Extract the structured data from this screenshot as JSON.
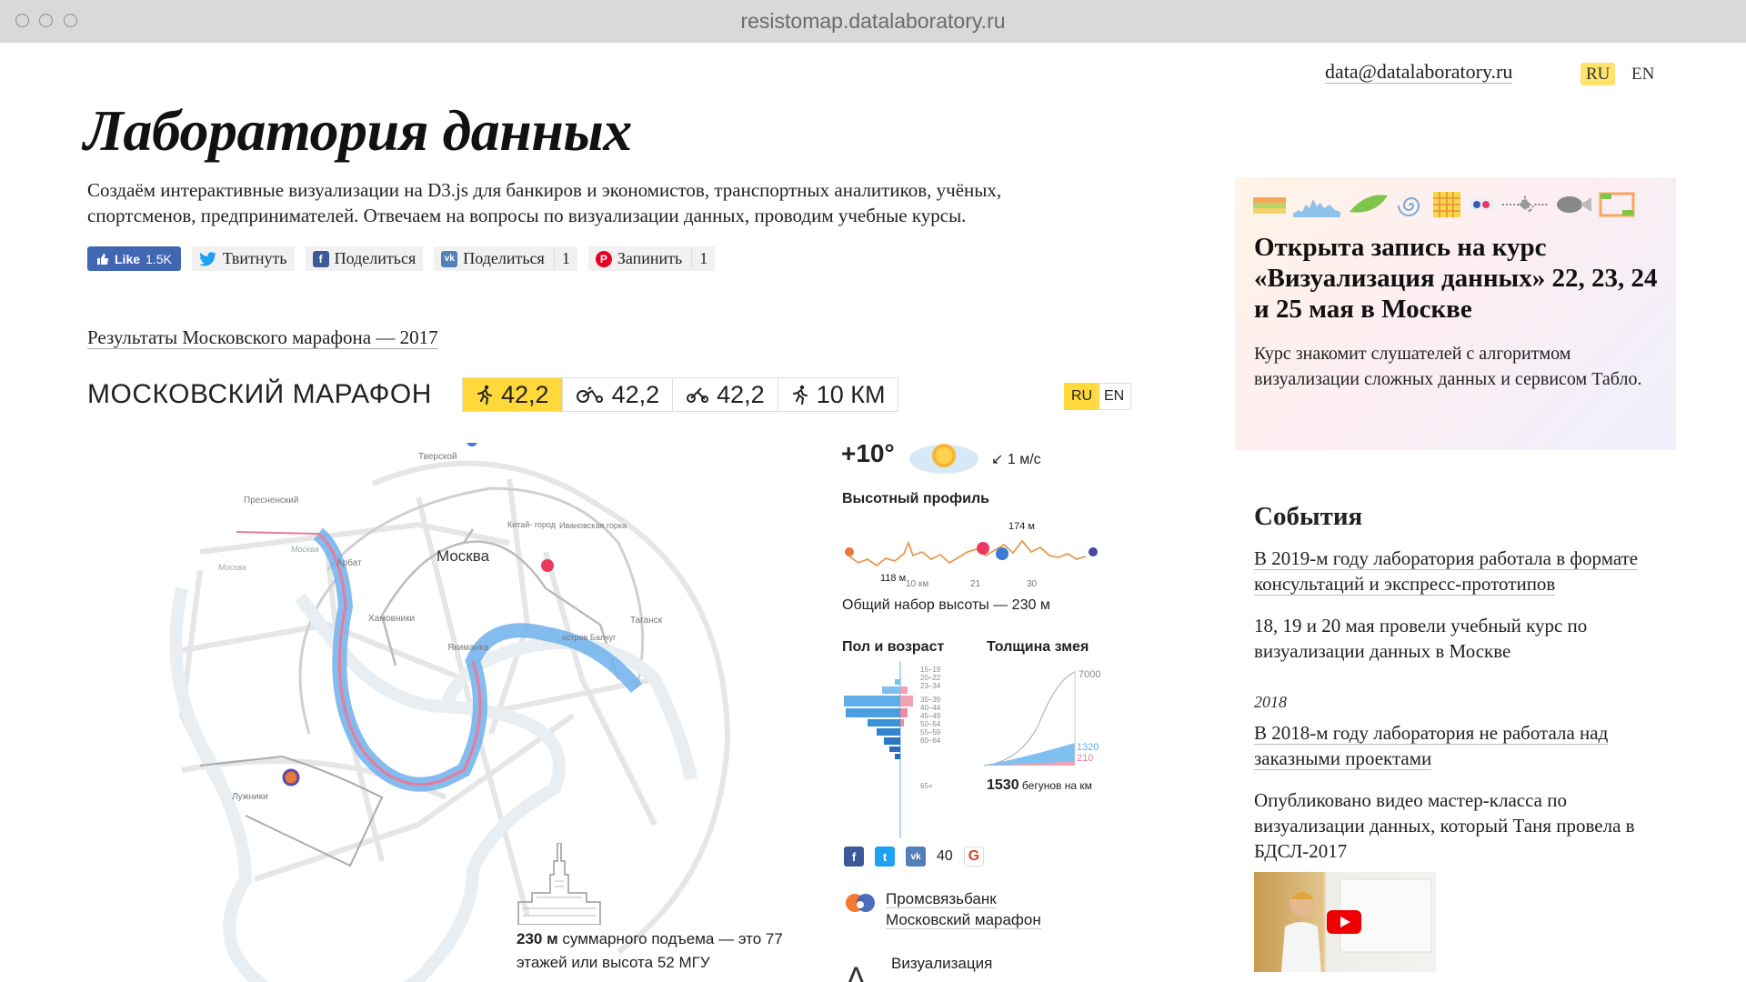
{
  "browser": {
    "url": "resistomap.datalaboratory.ru"
  },
  "header": {
    "email": "data@datalaboratory.ru",
    "lang_active": "RU",
    "lang_other": "EN"
  },
  "site": {
    "title": "Лаборатория данных",
    "intro": "Создаём интерактивные визуализации на D3.js для банкиров и экономистов, транспортных аналитиков, учёных, спортсменов, предпринимателей. Отвечаем на вопросы по визуализации данных, проводим учебные курсы."
  },
  "share": {
    "fb_like_label": "Like",
    "fb_like_count": "1.5K",
    "twitter_label": "Твитнуть",
    "facebook_label": "Поделиться",
    "vk_label": "Поделиться",
    "vk_count": "1",
    "pinterest_label": "Запинить",
    "pinterest_count": "1"
  },
  "results_link": "Результаты Московского марафона — 2017",
  "widget": {
    "title": "МОСКОВСКИЙ МАРАФОН",
    "tabs": [
      {
        "label": "42,2",
        "icon": "runner-icon",
        "active": true
      },
      {
        "label": "42,2",
        "icon": "wheelchair-icon",
        "active": false
      },
      {
        "label": "42,2",
        "icon": "handbike-icon",
        "active": false
      },
      {
        "label": "10 КМ",
        "icon": "runner-icon",
        "active": false
      }
    ],
    "lang_active": "RU",
    "lang_other": "EN",
    "map_labels": {
      "moscow": "Москва",
      "tverskoy": "Тверской",
      "presnensky": "Пресненский",
      "arbat": "Арбат",
      "kitay_gorod": "Китай-\nгород",
      "ivanovskaya": "Ивановская\nгорка",
      "khamovniki": "Хамовники",
      "yakimanka": "Якиманка",
      "ostrov": "остров Балчуг",
      "taganka": "Таганск",
      "luzhniki": "Лужники",
      "river1": "Москва",
      "river2": "Москва"
    },
    "climb_bold": "230 м",
    "climb_text": " суммарного подъема — это 77 этажей или высота",
    "climb_text2": "52 МГУ",
    "weather": {
      "temp": "+10°",
      "wind": "1 м/с"
    },
    "elevation": {
      "title": "Высотный профиль",
      "max_label": "174 м",
      "min_label": "118 м",
      "km10": "10 км",
      "km21": "21",
      "km30": "30",
      "total": "Общий набор высоты — 230 м"
    },
    "age": {
      "title": "Пол и возраст",
      "groups": [
        "15–19",
        "20–22",
        "23–34",
        "35–39",
        "40–44",
        "45–49",
        "50–54",
        "55–59",
        "60–64",
        "65+"
      ]
    },
    "snake": {
      "title": "Толщина змея",
      "top": "7000",
      "mid1": "1320",
      "mid2": "210",
      "caption_bold": "1530",
      "caption_text": " бегунов на км"
    },
    "social": {
      "vk_count": "40"
    },
    "sponsor": {
      "line1": "Промсвязьбанк",
      "line2": "Московский марафон"
    },
    "viz_label": "Визуализация"
  },
  "promo": {
    "title": "Открыта запись на курс «Визуализация данных» 22, 23, 24 и 25 мая в Москве",
    "text": "Курс знакомит слушателей с алгоритмом визуализации сложных данных и сервисом Табло."
  },
  "events": {
    "heading": "События",
    "item1": "В 2019-м году лаборатория работала в формате консультаций и экспресс-прототипов",
    "item2": "18, 19 и 20 мая провели учебный курс по визуализации данных в Москве",
    "year": "2018",
    "item3": "В 2018-м году лаборатория не работала над заказными проектами",
    "item4": "Опубликовано видео мастер-класса по визуализации данных, который Таня провела в БДСЛ-2017"
  }
}
